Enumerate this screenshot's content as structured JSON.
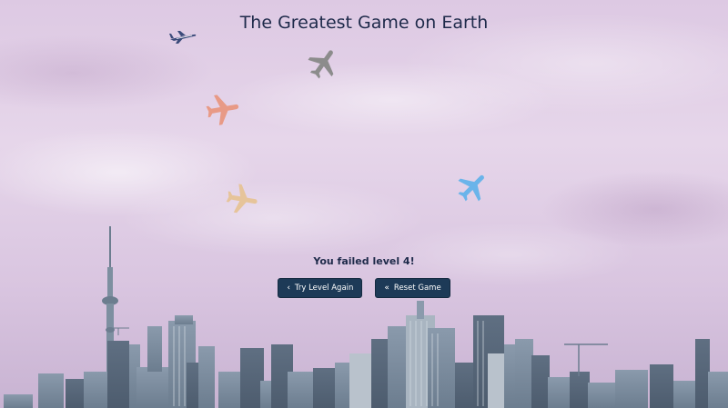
{
  "game": {
    "title": "The Greatest Game on Earth",
    "message": "You failed level 4!"
  },
  "buttons": {
    "try_again": {
      "label": "Try Level Again",
      "icon": "chevron-left-icon",
      "glyph": "‹"
    },
    "reset": {
      "label": "Reset Game",
      "icon": "double-chevron-left-icon",
      "glyph": "«"
    }
  },
  "planes": [
    {
      "name": "jet-airliner",
      "color": "#3a4a7a"
    },
    {
      "name": "gray-plane",
      "color": "#8c8c8c"
    },
    {
      "name": "coral-plane",
      "color": "#e89a86"
    },
    {
      "name": "tan-plane",
      "color": "#e6c49a"
    },
    {
      "name": "blue-plane",
      "color": "#6ab4ea"
    }
  ],
  "colors": {
    "sky_top": "#ddc9e3",
    "skyline": "#7d8fa0",
    "button_bg": "#1d3a57",
    "title_text": "#1e2a4a"
  }
}
